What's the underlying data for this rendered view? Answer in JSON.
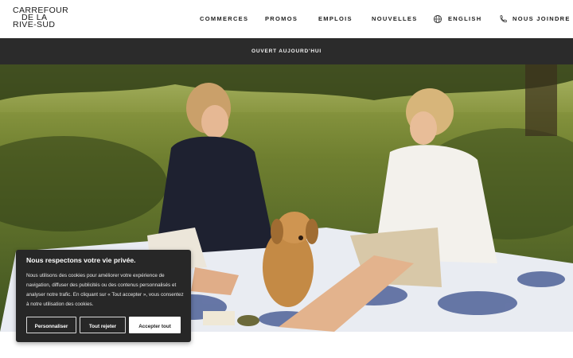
{
  "brand": {
    "line1": "CARREFOUR",
    "line2": "DE LA",
    "line3": "RIVE-SUD"
  },
  "nav": {
    "items": [
      {
        "label": "COMMERCES"
      },
      {
        "label": "PROMOS"
      },
      {
        "label": "EMPLOIS"
      },
      {
        "label": "NOUVELLES"
      }
    ],
    "language_label": "ENGLISH",
    "language_icon": "globe-icon",
    "contact_label": "NOUS JOINDRE",
    "contact_icon": "phone-icon"
  },
  "banner": {
    "text": "OUVERT AUJOURD'HUI"
  },
  "hero": {
    "image": "two-women-and-dog-picnic-on-grass"
  },
  "cookie": {
    "title": "Nous respectons votre vie privée.",
    "body": "Nous utilisons des cookies pour améliorer votre expérience de navigation, diffuser des publicités ou des contenus personnalisés et analyser notre trafic. En cliquant sur « Tout accepter », vous consentez à notre utilisation des cookies.",
    "customize_label": "Personnaliser",
    "reject_label": "Tout rejeter",
    "accept_label": "Accepter tout"
  },
  "colors": {
    "banner_bg": "#2b2b2b",
    "modal_bg": "#272727",
    "text_dark": "#1e1e1e",
    "white": "#ffffff"
  }
}
